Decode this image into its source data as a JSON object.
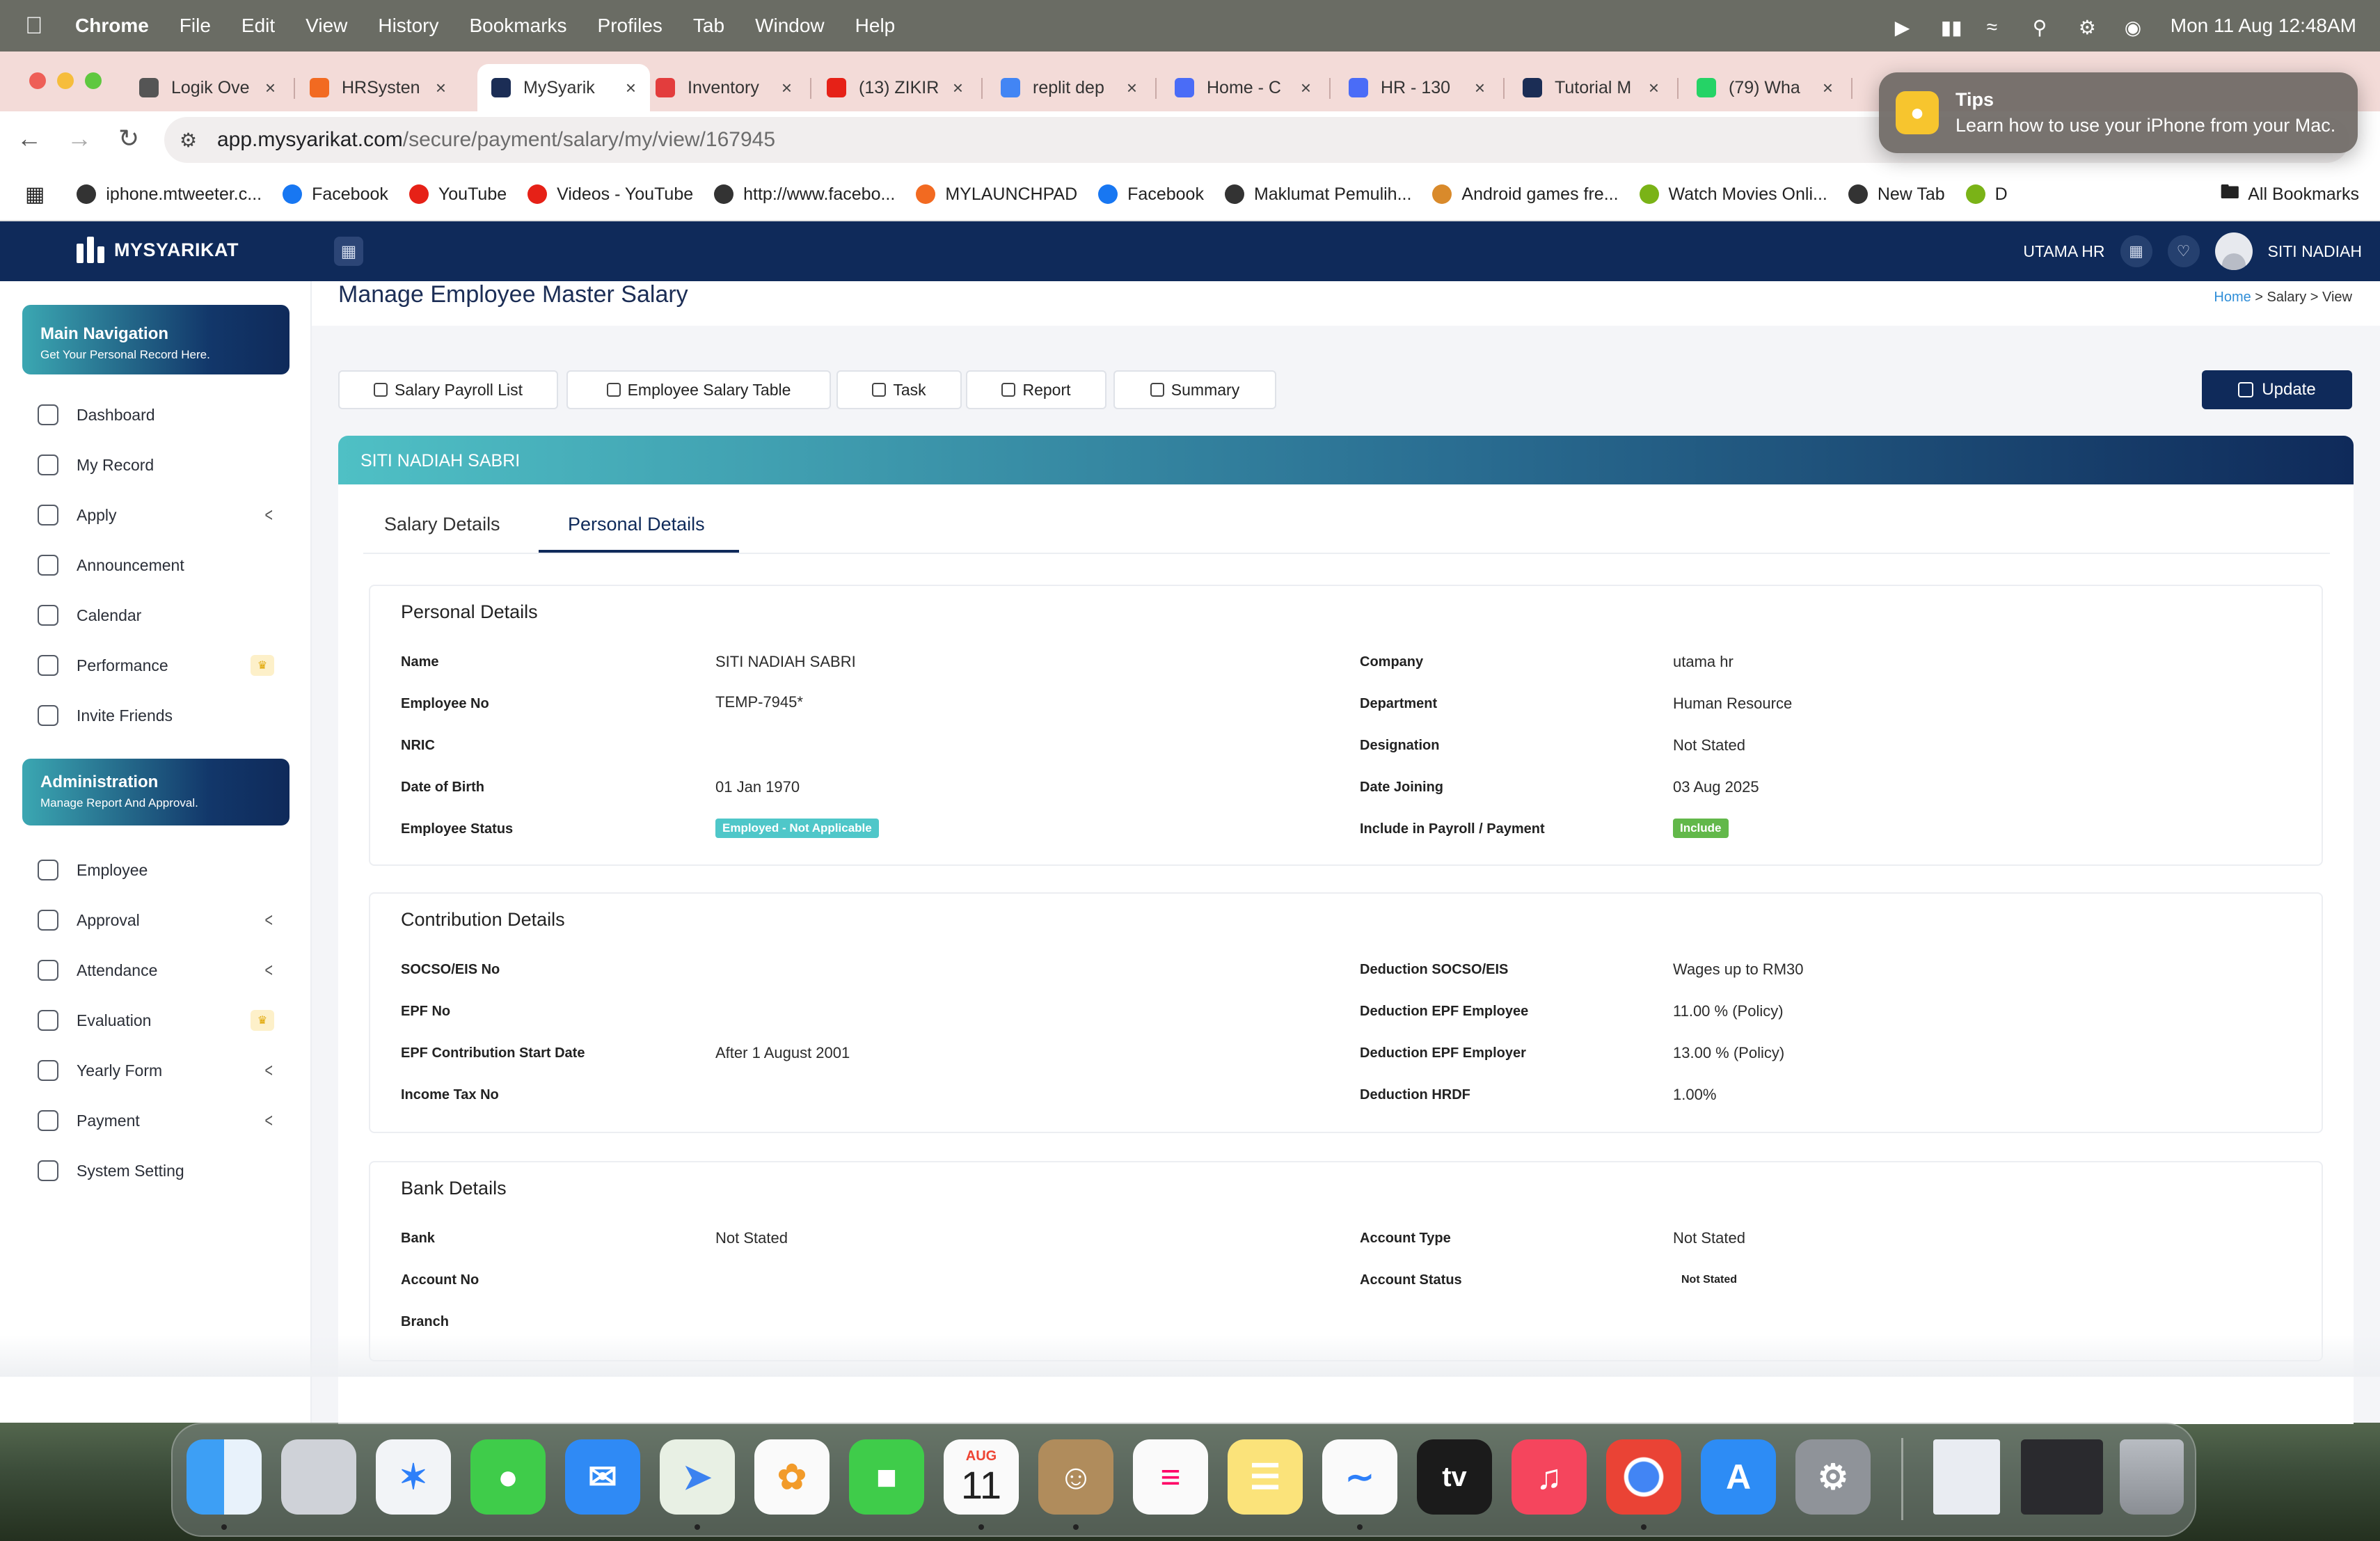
{
  "menubar": {
    "app": "Chrome",
    "items": [
      "File",
      "Edit",
      "View",
      "History",
      "Bookmarks",
      "Profiles",
      "Tab",
      "Window",
      "Help"
    ],
    "datetime": "Mon 11 Aug  12:48AM"
  },
  "browser": {
    "tabs": [
      {
        "title": "Logik Ove",
        "color": "#555"
      },
      {
        "title": "HRSysten",
        "color": "#f26a21"
      },
      {
        "title": "MySyarik",
        "color": "#1b2d55"
      },
      {
        "title": "Inventory",
        "color": "#e33d3d"
      },
      {
        "title": "(13) ZIKIR",
        "color": "#e62117"
      },
      {
        "title": "replit dep",
        "color": "#4285f4"
      },
      {
        "title": "Home - C",
        "color": "#4a6cf7"
      },
      {
        "title": "HR - 130",
        "color": "#4a6cf7"
      },
      {
        "title": "Tutorial M",
        "color": "#1b2d55"
      },
      {
        "title": "(79) Wha",
        "color": "#25d366"
      }
    ],
    "url_host": "app.mysyarikat.com",
    "url_path": "/secure/payment/salary/my/view/167945",
    "bookmarks": [
      {
        "label": "iphone.mtweeter.c...",
        "color": "#333"
      },
      {
        "label": "Facebook",
        "color": "#1877f2"
      },
      {
        "label": "YouTube",
        "color": "#e62117"
      },
      {
        "label": "Videos - YouTube",
        "color": "#e62117"
      },
      {
        "label": "http://www.facebo...",
        "color": "#333"
      },
      {
        "label": "MYLAUNCHPAD",
        "color": "#f26a21"
      },
      {
        "label": "Facebook",
        "color": "#1877f2"
      },
      {
        "label": "Maklumat Pemulih...",
        "color": "#333"
      },
      {
        "label": "Android games fre...",
        "color": "#d98a2b"
      },
      {
        "label": "Watch Movies Onli...",
        "color": "#7ab317"
      },
      {
        "label": "New Tab",
        "color": "#333"
      },
      {
        "label": "D",
        "color": "#7ab317"
      }
    ],
    "all_bookmarks": "All Bookmarks"
  },
  "tips": {
    "title": "Tips",
    "text": "Learn how to use your iPhone from your Mac."
  },
  "app": {
    "brand": "MYSYARIKAT",
    "company": "UTAMA HR",
    "user": "SITI NADIAH",
    "main_nav": {
      "title": "Main Navigation",
      "subtitle": "Get Your Personal Record Here."
    },
    "main_items": [
      {
        "label": "Dashboard",
        "name": "dashboard"
      },
      {
        "label": "My Record",
        "name": "my-record"
      },
      {
        "label": "Apply",
        "name": "apply"
      },
      {
        "label": "Announcement",
        "name": "announcement"
      },
      {
        "label": "Calendar",
        "name": "calendar"
      },
      {
        "label": "Performance",
        "name": "performance"
      },
      {
        "label": "Invite Friends",
        "name": "invite-friends"
      }
    ],
    "admin_nav": {
      "title": "Administration",
      "subtitle": "Manage Report And Approval."
    },
    "admin_items": [
      {
        "label": "Employee",
        "name": "employee"
      },
      {
        "label": "Approval",
        "name": "approval"
      },
      {
        "label": "Attendance",
        "name": "attendance"
      },
      {
        "label": "Evaluation",
        "name": "evaluation"
      },
      {
        "label": "Yearly Form",
        "name": "yearly-form"
      },
      {
        "label": "Payment",
        "name": "payment"
      },
      {
        "label": "System Setting",
        "name": "system-setting"
      }
    ]
  },
  "page": {
    "title": "Manage Employee Master Salary",
    "breadcrumb": {
      "home": "Home",
      "rest": " > Salary > View"
    },
    "toolbar": [
      "Salary Payroll List",
      "Employee Salary Table",
      "Task",
      "Report",
      "Summary"
    ],
    "update": "Update",
    "employee_name": "SITI NADIAH SABRI",
    "tabs": [
      "Salary Details",
      "Personal Details"
    ],
    "personal": {
      "title": "Personal Details",
      "name_label": "Name",
      "name": "SITI NADIAH SABRI",
      "empno_label": "Employee No",
      "empno": "TEMP-7945*",
      "nric_label": "NRIC",
      "dob_label": "Date of Birth",
      "dob": "01 Jan 1970",
      "status_label": "Employee Status",
      "status": "Employed - Not Applicable",
      "company_label": "Company",
      "company": "utama hr",
      "dept_label": "Department",
      "dept": "Human Resource",
      "desig_label": "Designation",
      "desig": "Not Stated",
      "joining_label": "Date Joining",
      "joining": "03 Aug 2025",
      "payroll_label": "Include in Payroll / Payment",
      "payroll": "Include"
    },
    "contribution": {
      "title": "Contribution Details",
      "socso_label": "SOCSO/EIS No",
      "epf_label": "EPF No",
      "epfstart_label": "EPF Contribution Start Date",
      "epfstart": "After 1 August 2001",
      "tax_label": "Income Tax No",
      "dsocso_label": "Deduction SOCSO/EIS",
      "dsocso": "Wages up to RM30",
      "depfe_label": "Deduction EPF Employee",
      "depfe": "11.00 % (Policy)",
      "depfr_label": "Deduction EPF Employer",
      "depfr": "13.00 % (Policy)",
      "dhrdf_label": "Deduction HRDF",
      "dhrdf": "1.00%"
    },
    "bank": {
      "title": "Bank Details",
      "bank_label": "Bank",
      "bank": "Not Stated",
      "acc_label": "Account No",
      "branch_label": "Branch",
      "acctype_label": "Account Type",
      "acctype": "Not Stated",
      "accstatus_label": "Account Status",
      "accstatus": "Not Stated"
    }
  },
  "dock": {
    "calendar_month": "AUG",
    "calendar_day": "11",
    "tv": "tv"
  }
}
